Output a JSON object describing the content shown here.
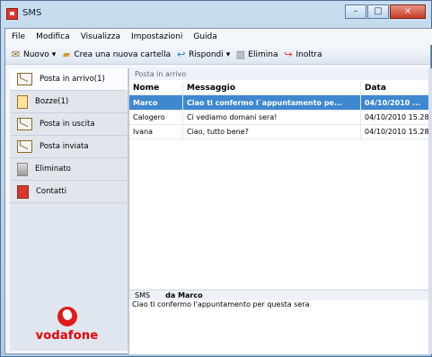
{
  "window": {
    "title": "SMS"
  },
  "menu": [
    "File",
    "Modifica",
    "Visualizza",
    "Impostazioni",
    "Guida"
  ],
  "toolbar": {
    "new": "Nuovo",
    "create_folder": "Crea una nuova cartella",
    "reply": "Rispondi",
    "delete": "Elimina",
    "forward": "Inoltra"
  },
  "sidebar": {
    "items": [
      {
        "label": "Posta in arrivo(1)",
        "icon": "inbox-icon"
      },
      {
        "label": "Bozze(1)",
        "icon": "draft-icon"
      },
      {
        "label": "Posta in uscita",
        "icon": "outbox-icon"
      },
      {
        "label": "Posta inviata",
        "icon": "sent-icon"
      },
      {
        "label": "Eliminato",
        "icon": "trash-icon"
      },
      {
        "label": "Contatti",
        "icon": "contacts-icon"
      }
    ],
    "brand": "vodafone"
  },
  "inbox": {
    "title": "Posta in arrivo",
    "columns": [
      "Nome",
      "Messaggio",
      "Data"
    ],
    "rows": [
      {
        "name": "Marco",
        "message": "Ciao ti confermo l`appuntamento pe...",
        "date": "04/10/2010 ..."
      },
      {
        "name": "Calogero",
        "message": "Ci vediamo domani sera!",
        "date": "04/10/2010 15.28"
      },
      {
        "name": "Ivana",
        "message": "Ciao, tutto bene?",
        "date": "04/10/2010 15.28"
      }
    ]
  },
  "preview": {
    "type": "SMS",
    "from": "da Marco",
    "message": "Ciao ti confermo l'appuntamento per questa sera"
  },
  "colors": {
    "selection": "#3f88cf",
    "brand_red": "#e60000"
  }
}
